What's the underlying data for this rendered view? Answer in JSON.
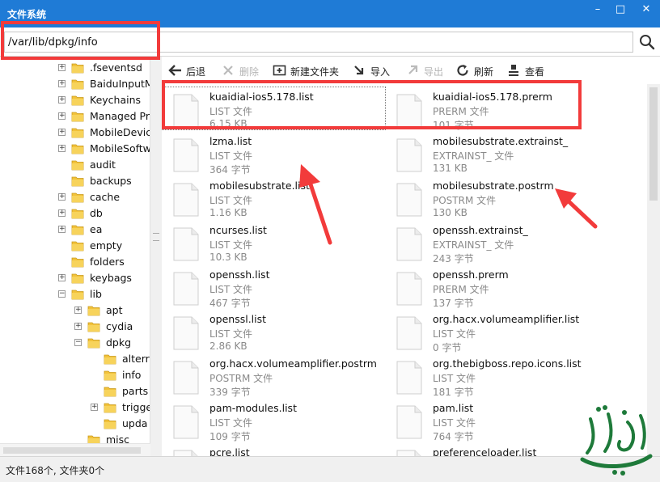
{
  "window": {
    "title": "文件系统",
    "minimize": "–",
    "maximize": "□",
    "close": "✕"
  },
  "address": {
    "path": "/var/lib/dpkg/info"
  },
  "tree": {
    "items": [
      {
        "label": ".fseventsd",
        "expander": "+",
        "level": 0
      },
      {
        "label": "BaiduInputM",
        "expander": "+",
        "level": 0
      },
      {
        "label": "Keychains",
        "expander": "+",
        "level": 0
      },
      {
        "label": "Managed Pr",
        "expander": "+",
        "level": 0
      },
      {
        "label": "MobileDevic",
        "expander": "+",
        "level": 0
      },
      {
        "label": "MobileSoftw",
        "expander": "+",
        "level": 0
      },
      {
        "label": "audit",
        "expander": "",
        "level": 0
      },
      {
        "label": "backups",
        "expander": "",
        "level": 0
      },
      {
        "label": "cache",
        "expander": "+",
        "level": 0
      },
      {
        "label": "db",
        "expander": "+",
        "level": 0
      },
      {
        "label": "ea",
        "expander": "+",
        "level": 0
      },
      {
        "label": "empty",
        "expander": "",
        "level": 0
      },
      {
        "label": "folders",
        "expander": "",
        "level": 0
      },
      {
        "label": "keybags",
        "expander": "+",
        "level": 0
      },
      {
        "label": "lib",
        "expander": "−",
        "level": 0
      },
      {
        "label": "apt",
        "expander": "+",
        "level": 1
      },
      {
        "label": "cydia",
        "expander": "+",
        "level": 1
      },
      {
        "label": "dpkg",
        "expander": "−",
        "level": 1
      },
      {
        "label": "alterr",
        "expander": "",
        "level": 2
      },
      {
        "label": "info",
        "expander": "",
        "level": 2
      },
      {
        "label": "parts",
        "expander": "",
        "level": 2
      },
      {
        "label": "trigge",
        "expander": "+",
        "level": 2
      },
      {
        "label": "upda",
        "expander": "",
        "level": 2
      },
      {
        "label": "misc",
        "expander": "",
        "level": 1
      }
    ]
  },
  "toolbar": {
    "back": "后退",
    "delete": "删除",
    "new_folder": "新建文件夹",
    "import": "导入",
    "export": "导出",
    "refresh": "刷新",
    "view": "查看"
  },
  "files": [
    {
      "name": "kuaidial-ios5.178.list",
      "type": "LIST 文件",
      "size": "6.15 KB"
    },
    {
      "name": "kuaidial-ios5.178.prerm",
      "type": "PRERM 文件",
      "size": "101 字节"
    },
    {
      "name": "lzma.list",
      "type": "LIST 文件",
      "size": "364 字节"
    },
    {
      "name": "mobilesubstrate.extrainst_",
      "type": "EXTRAINST_ 文件",
      "size": "131 KB"
    },
    {
      "name": "mobilesubstrate.list",
      "type": "LIST 文件",
      "size": "1.16 KB"
    },
    {
      "name": "mobilesubstrate.postrm",
      "type": "POSTRM 文件",
      "size": "130 KB"
    },
    {
      "name": "ncurses.list",
      "type": "LIST 文件",
      "size": "10.3 KB"
    },
    {
      "name": "openssh.extrainst_",
      "type": "EXTRAINST_ 文件",
      "size": "243 字节"
    },
    {
      "name": "openssh.list",
      "type": "LIST 文件",
      "size": "467 字节"
    },
    {
      "name": "openssh.prerm",
      "type": "PRERM 文件",
      "size": "137 字节"
    },
    {
      "name": "openssl.list",
      "type": "LIST 文件",
      "size": "2.86 KB"
    },
    {
      "name": "org.hacx.volumeamplifier.list",
      "type": "LIST 文件",
      "size": "0 字节"
    },
    {
      "name": "org.hacx.volumeamplifier.postrm",
      "type": "POSTRM 文件",
      "size": "339 字节"
    },
    {
      "name": "org.thebigboss.repo.icons.list",
      "type": "LIST 文件",
      "size": "181 字节"
    },
    {
      "name": "pam-modules.list",
      "type": "LIST 文件",
      "size": "109 字节"
    },
    {
      "name": "pam.list",
      "type": "LIST 文件",
      "size": "764 字节"
    },
    {
      "name": "pcre.list",
      "type": "",
      "size": ""
    },
    {
      "name": "preferenceloader.list",
      "type": "",
      "size": ""
    }
  ],
  "status": {
    "text": "文件168个, 文件夹0个"
  },
  "colors": {
    "titlebar": "#1f7bd6",
    "highlight": "#f23b3b",
    "folder": "#f2c23a",
    "watermark": "#1e7a3a"
  }
}
